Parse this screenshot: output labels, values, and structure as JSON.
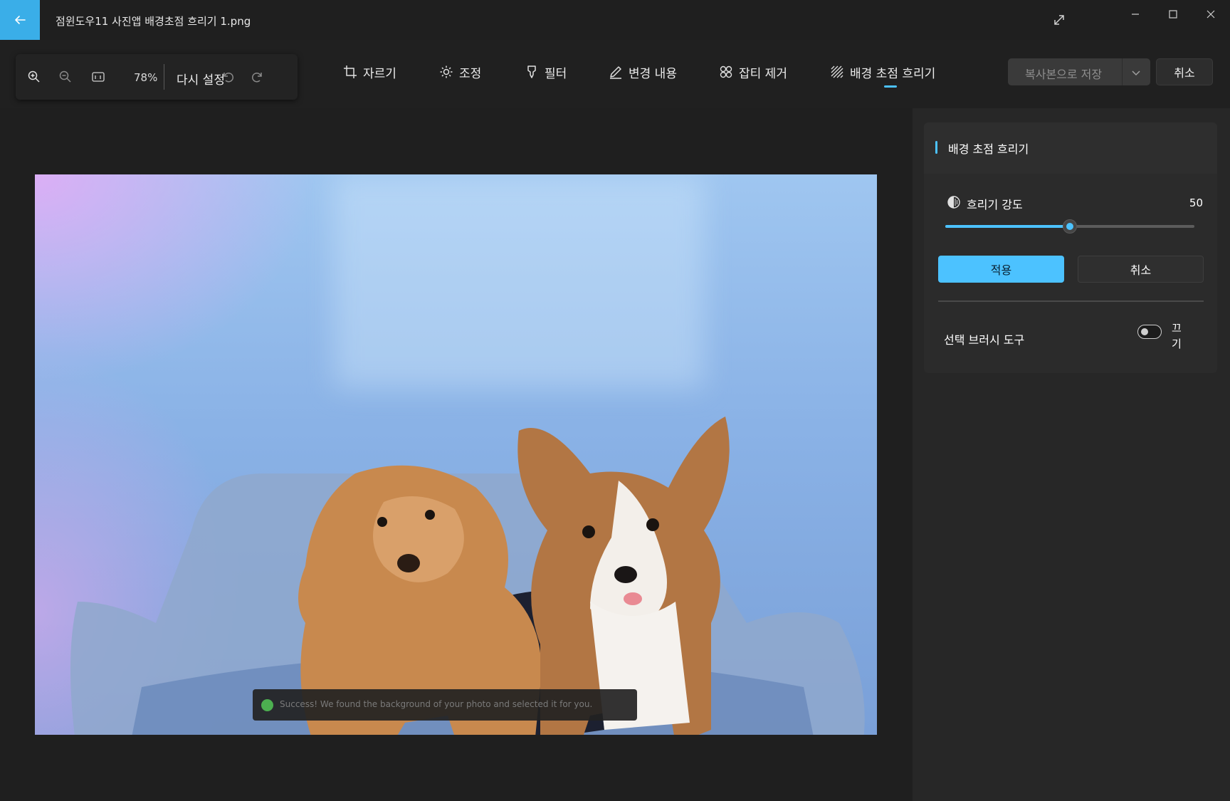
{
  "window": {
    "title": "점윈도우11 사진앱 배경초점 흐리기 1.png"
  },
  "toolbar": {
    "zoom_percent": "78%",
    "reset_label": "다시 설정",
    "tools": [
      {
        "label": "자르기",
        "icon": "crop-icon"
      },
      {
        "label": "조정",
        "icon": "brightness-icon"
      },
      {
        "label": "필터",
        "icon": "filter-icon"
      },
      {
        "label": "변경 내용",
        "icon": "markup-pen-icon"
      },
      {
        "label": "잡티 제거",
        "icon": "spot-fix-icon"
      },
      {
        "label": "배경 초점 흐리기",
        "icon": "background-blur-icon",
        "active": true
      }
    ],
    "save_copy_label": "복사본으로 저장",
    "cancel_label": "취소"
  },
  "canvas": {
    "toast_text": "Success! We found the background of your photo and selected it for you."
  },
  "panel": {
    "title": "배경 초점 흐리기",
    "blur_intensity_label": "흐리기 강도",
    "blur_intensity_value": "50",
    "blur_intensity_fraction": 0.5,
    "apply_label": "적용",
    "cancel_label": "취소",
    "brush_tool_label": "선택 브러시 도구",
    "brush_tool_state": "끄기"
  },
  "colors": {
    "accent": "#4cc2ff",
    "back_button": "#3aaee8",
    "background": "#202020",
    "toast_success": "#4caf50"
  }
}
